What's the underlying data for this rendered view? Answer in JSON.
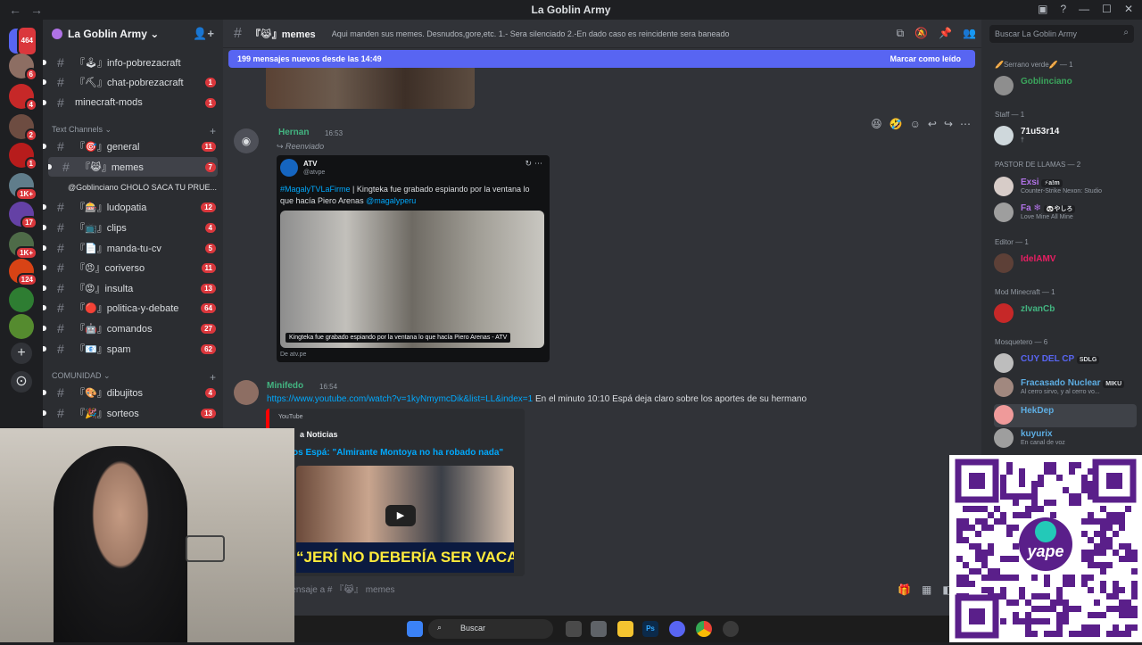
{
  "window": {
    "title": "La Goblin Army",
    "back": "←",
    "forward": "→"
  },
  "guilds": [
    {
      "color": "#5865f2",
      "badge": "464",
      "glyph": "◉"
    },
    {
      "color": "#8d6e63",
      "badge": "6"
    },
    {
      "color": "#c62828",
      "badge": "4"
    },
    {
      "color": "#6d4c41",
      "badge": "2"
    },
    {
      "color": "#b71c1c",
      "badge": "1"
    },
    {
      "color": "#607d8b",
      "badge": "1K+"
    },
    {
      "color": "#6441a5",
      "badge": "17"
    },
    {
      "color": "#4e6b48",
      "badge": "1K+"
    },
    {
      "color": "#d84315",
      "badge": "124"
    },
    {
      "color": "#2e7d32",
      "badge": ""
    },
    {
      "color": "#558b2f",
      "badge": ""
    }
  ],
  "server": {
    "name": "La Goblin Army",
    "invite_icon": "👤+"
  },
  "channels_top": [
    {
      "name": "『🕹』info-pobrezacraft",
      "count": ""
    },
    {
      "name": "『⛏』chat-pobrezacraft",
      "count": "1"
    },
    {
      "name": "minecraft-mods",
      "count": "1"
    }
  ],
  "category_text": "Text Channels",
  "category_comunidad": "COMUNIDAD",
  "channels_text": [
    {
      "name": "『🎯』general",
      "count": "11"
    },
    {
      "name": "『😹』memes",
      "count": "7"
    },
    {
      "name": "『🎰』ludopatia",
      "count": "12"
    },
    {
      "name": "『📺』clips",
      "count": "4"
    },
    {
      "name": "『📄』manda-tu-cv",
      "count": "5"
    },
    {
      "name": "『😠』coriverso",
      "count": "11"
    },
    {
      "name": "『😡』insulta",
      "count": "13"
    },
    {
      "name": "『🔴』politica-y-debate",
      "count": "64"
    },
    {
      "name": "『🤖』comandos",
      "count": "27"
    },
    {
      "name": "『📧』spam",
      "count": "62"
    }
  ],
  "thread": "@Goblinciano CHOLO SACA TU PRUE...",
  "channels_comunidad": [
    {
      "name": "『🎨』dibujitos",
      "count": "4"
    },
    {
      "name": "『🎉』sorteos",
      "count": "13"
    }
  ],
  "topbar": {
    "channel": "『😹』memes",
    "topic": "Aqui manden sus memes. Desnudos,gore,etc. 1.- Sera silenciado 2.-En dado caso es reincidente sera baneado"
  },
  "newbar": {
    "text": "199 mensajes nuevos desde las 14:49",
    "mark": "Marcar como leído"
  },
  "messages": [
    {
      "author": "Hernan",
      "author_color": "#43b581",
      "time": "16:53",
      "forwarded": "↪ Reenviado",
      "embed": {
        "account": "ATV",
        "handle": "@atvpe",
        "hashtag": "#MagalyTVLaFirme",
        "text": " | Kingteka fue grabado espiando por la ventana lo que hacía Piero Arenas ",
        "mention": "@magalyperu",
        "caption": "Kingteka fue grabado espiando por la ventana lo que hacía Piero Arenas - ATV",
        "source": "De atv.pe"
      }
    },
    {
      "author": "Minifedo",
      "author_color": "#43b581",
      "time": "16:54",
      "link": "https://www.youtube.com/watch?v=1kyNmymcDik&list=LL&index=1",
      "text": " En el minuto 10:10 Espá deja claro sobre los aportes de su hermano",
      "embed": {
        "provider": "YouTube",
        "channel": "a Noticias",
        "title": "os Espá: \"Almirante Montoya no ha robado nada\"",
        "thumb_text": "“JERÍ NO DEBERÍA SER VACADO”"
      }
    }
  ],
  "composer": {
    "placeholder": "mensaje a # 『😹』 memes"
  },
  "members": {
    "search": "Buscar La Goblin Army",
    "groups": [
      {
        "label": "🥖Serrano verde🥖 — 1",
        "items": [
          {
            "name": "Goblinciano",
            "color": "#3ba55c",
            "status": "",
            "av": "#8e8e8e"
          }
        ]
      },
      {
        "label": "Staff — 1",
        "items": [
          {
            "name": "71u53r14",
            "color": "#f2f3f5",
            "status": "†",
            "av": "#cfd8dc"
          }
        ]
      },
      {
        "label": "PASTOR DE LLAMAS — 2",
        "items": [
          {
            "name": "Exsi",
            "tag": "⚡a!m",
            "color": "#b072e6",
            "status": "Counter-Strike Nexon: Studio",
            "av": "#d7ccc8"
          },
          {
            "name": "Fa ❄",
            "tag": "🐼やしろ",
            "color": "#b072e6",
            "status": "Love Mine All Mine",
            "av": "#9e9e9e"
          }
        ]
      },
      {
        "label": "Editor — 1",
        "items": [
          {
            "name": "IdelAMV",
            "color": "#e91e63",
            "status": "",
            "av": "#5d4037"
          }
        ]
      },
      {
        "label": "Mod Minecraft — 1",
        "items": [
          {
            "name": "zIvanCb",
            "color": "#43b581",
            "status": "",
            "av": "#c62828"
          }
        ]
      },
      {
        "label": "Mosquetero — 6",
        "items": [
          {
            "name": "CUY DEL CP",
            "tag": "SDLG",
            "color": "#5865f2",
            "status": "",
            "av": "#bdbdbd"
          },
          {
            "name": "Fracasado Nuclear",
            "tag": "MIKU",
            "color": "#5dade2",
            "status": "Al cerro sirvo, y al cerro vo...",
            "av": "#a1887f"
          },
          {
            "name": "HekDep",
            "color": "#5dade2",
            "status": "",
            "av": "#ef9a9a"
          },
          {
            "name": "kuyurix",
            "color": "#5dade2",
            "status": "En canal de voz",
            "av": "#9e9e9e"
          }
        ]
      }
    ]
  },
  "taskbar": {
    "search": "Buscar"
  }
}
